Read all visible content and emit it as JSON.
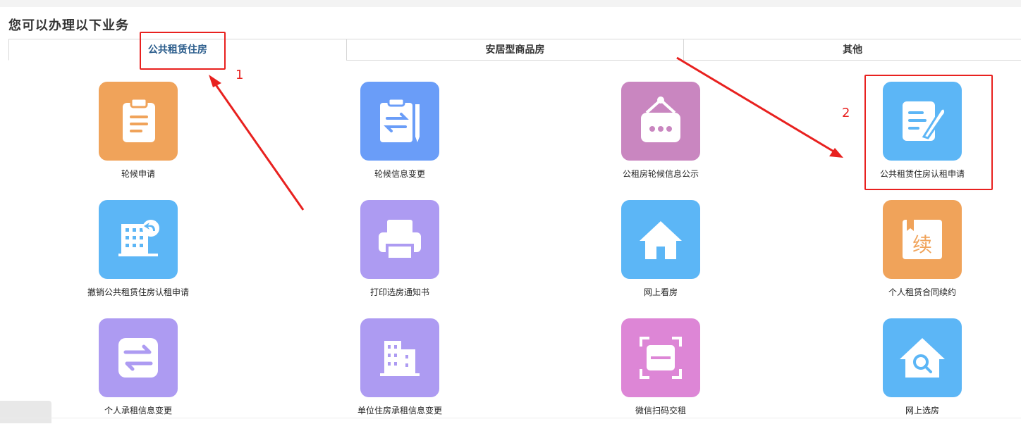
{
  "heading": "您可以办理以下业务",
  "tabs": [
    {
      "label": "公共租赁住房",
      "active": true
    },
    {
      "label": "安居型商品房",
      "active": false
    },
    {
      "label": "其他",
      "active": false
    }
  ],
  "tiles": [
    {
      "label": "轮候申请",
      "color": "#f0a35a",
      "icon": "clipboard-icon"
    },
    {
      "label": "轮候信息变更",
      "color": "#6a9df8",
      "icon": "clipboard-swap-icon"
    },
    {
      "label": "公租房轮候信息公示",
      "color": "#c986c0",
      "icon": "hanging-sign-icon"
    },
    {
      "label": "公共租赁住房认租申请",
      "color": "#5cb6f6",
      "icon": "document-edit-icon"
    },
    {
      "label": "撤销公共租赁住房认租申请",
      "color": "#5cb6f6",
      "icon": "building-undo-icon"
    },
    {
      "label": "打印选房通知书",
      "color": "#ad9bf2",
      "icon": "printer-icon"
    },
    {
      "label": "网上看房",
      "color": "#5cb6f6",
      "icon": "house-icon"
    },
    {
      "label": "个人租赁合同续约",
      "color": "#f0a35a",
      "icon": "renew-book-icon",
      "glyph": "续"
    },
    {
      "label": "个人承租信息变更",
      "color": "#ad9bf2",
      "icon": "swap-arrows-icon"
    },
    {
      "label": "单位住房承租信息变更",
      "color": "#ad9bf2",
      "icon": "office-building-icon"
    },
    {
      "label": "微信扫码交租",
      "color": "#dd86d6",
      "icon": "scan-icon"
    },
    {
      "label": "网上选房",
      "color": "#5cb6f6",
      "icon": "house-search-icon"
    }
  ],
  "annotations": {
    "step1": "1",
    "step2": "2",
    "color": "#e8211f"
  }
}
